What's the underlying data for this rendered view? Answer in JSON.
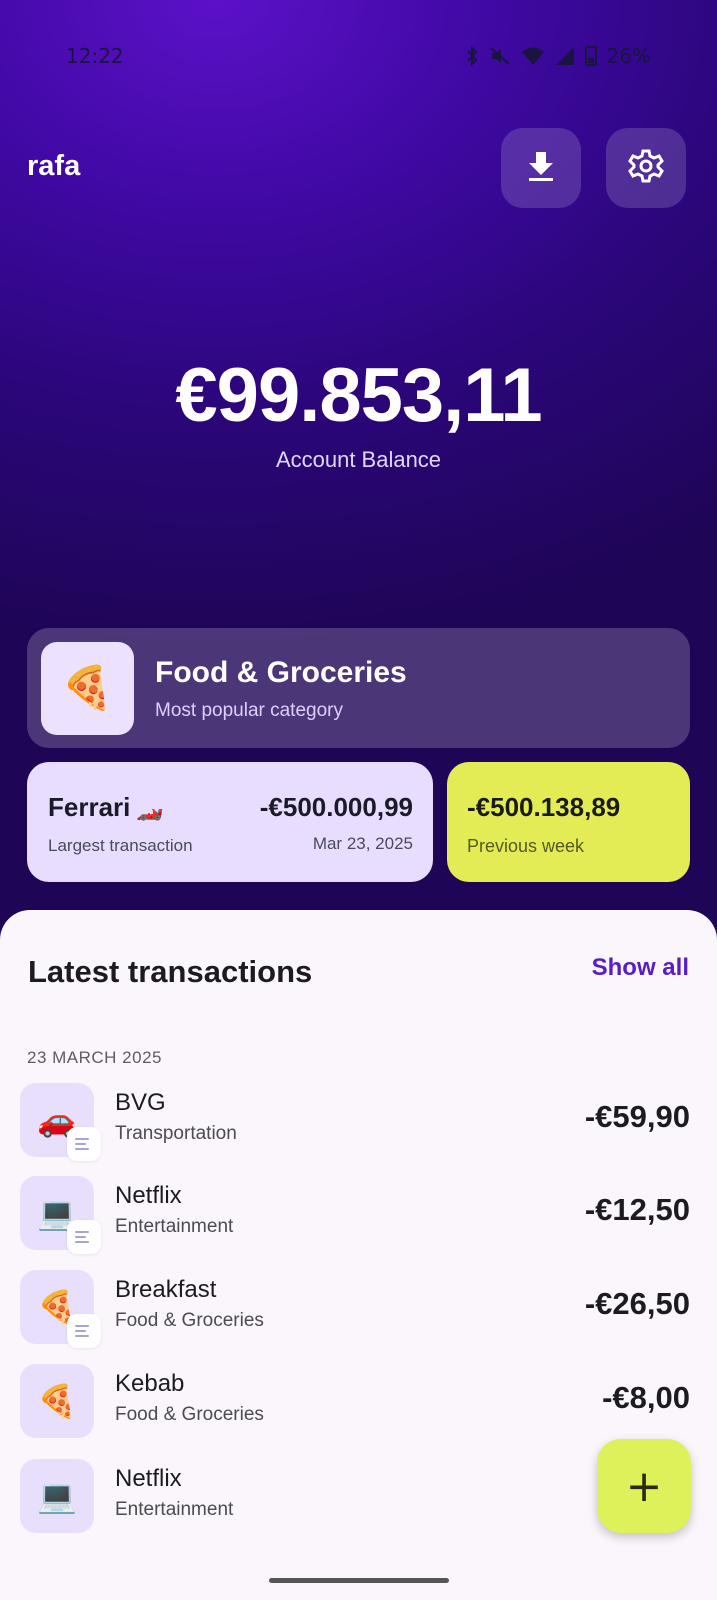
{
  "status_bar": {
    "time": "12:22",
    "battery": "26%"
  },
  "header": {
    "username": "rafa"
  },
  "balance": {
    "amount": "€99.853,11",
    "label": "Account Balance"
  },
  "popular_category": {
    "icon": "🍕",
    "title": "Food & Groceries",
    "subtitle": "Most popular category"
  },
  "largest_transaction": {
    "name": "Ferrari",
    "icon": "🏎️",
    "label": "Largest transaction",
    "amount": "-€500.000,99",
    "date": "Mar 23, 2025"
  },
  "previous_week": {
    "amount": "-€500.138,89",
    "label": "Previous week"
  },
  "transactions": {
    "title": "Latest transactions",
    "show_all": "Show all",
    "date_header": "23 MARCH 2025",
    "items": [
      {
        "icon": "🚗",
        "name": "BVG",
        "category": "Transportation",
        "amount": "-€59,90",
        "has_note": true
      },
      {
        "icon": "💻",
        "name": "Netflix",
        "category": "Entertainment",
        "amount": "-€12,50",
        "has_note": true
      },
      {
        "icon": "🍕",
        "name": "Breakfast",
        "category": "Food & Groceries",
        "amount": "-€26,50",
        "has_note": true
      },
      {
        "icon": "🍕",
        "name": "Kebab",
        "category": "Food & Groceries",
        "amount": "-€8,00",
        "has_note": false
      },
      {
        "icon": "💻",
        "name": "Netflix",
        "category": "Entertainment",
        "amount": "-€",
        "has_note": false
      }
    ]
  },
  "fab": {
    "label": "+"
  },
  "colors": {
    "accent": "#5a1dc5",
    "hero": "#3d08a0",
    "highlight": "#e3ec55",
    "card": "#e9ddff"
  }
}
